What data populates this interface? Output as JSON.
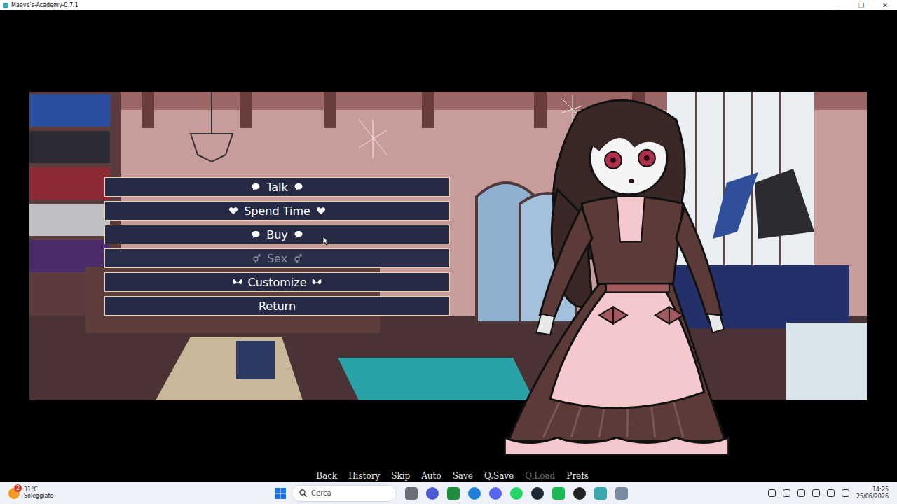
{
  "window": {
    "title": "Maeve's-Academy-0.7.1",
    "controls": [
      "—",
      "❐",
      "✕"
    ]
  },
  "menu": [
    {
      "label": "Talk",
      "kind": "chat",
      "disabled": false
    },
    {
      "label": "Spend Time",
      "kind": "heart",
      "disabled": false
    },
    {
      "label": "Buy",
      "kind": "chat",
      "disabled": false
    },
    {
      "label": "Sex",
      "kind": "gender",
      "disabled": true
    },
    {
      "label": "Customize",
      "kind": "garment",
      "disabled": false
    },
    {
      "label": "Return",
      "kind": "plain",
      "disabled": false
    }
  ],
  "quick_menu": [
    {
      "label": "Back",
      "disabled": false
    },
    {
      "label": "History",
      "disabled": false
    },
    {
      "label": "Skip",
      "disabled": false
    },
    {
      "label": "Auto",
      "disabled": false
    },
    {
      "label": "Save",
      "disabled": false
    },
    {
      "label": "Q.Save",
      "disabled": false
    },
    {
      "label": "Q.Load",
      "disabled": true
    },
    {
      "label": "Prefs",
      "disabled": false
    }
  ],
  "taskbar": {
    "weather": {
      "badge": "2",
      "temperature": "31°C",
      "condition": "Soleggiato"
    },
    "search": {
      "placeholder": "Cerca"
    },
    "clock": {
      "time": "14:25",
      "date": "25/06/2026"
    }
  }
}
